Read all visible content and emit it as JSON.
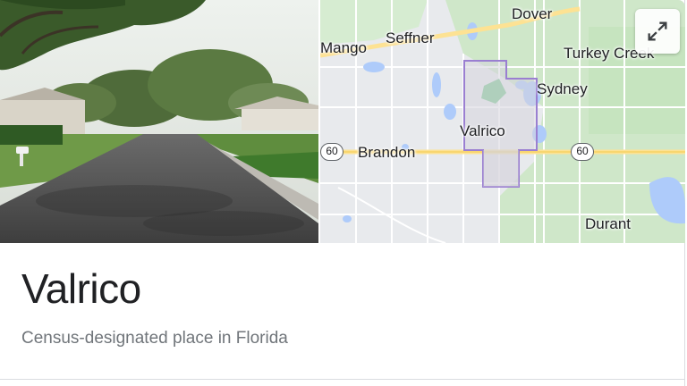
{
  "place": {
    "title": "Valrico",
    "subtitle": "Census-designated place in Florida"
  },
  "photo": {
    "alt": "Residential street in Valrico",
    "icon": "street-photo"
  },
  "map": {
    "labels": {
      "dover": "Dover",
      "seffner": "Seffner",
      "mango": "Mango",
      "turkey_creek": "Turkey Creek",
      "sydney": "Sydney",
      "valrico": "Valrico",
      "brandon": "Brandon",
      "durant": "Durant"
    },
    "route_shield": "60",
    "expand_icon": "expand-icon",
    "colors": {
      "land": "#e8eaed",
      "green": "#cde9c8",
      "water": "#aecbfa",
      "highway": "#fde293",
      "boundary": "#9a7fd1"
    }
  }
}
